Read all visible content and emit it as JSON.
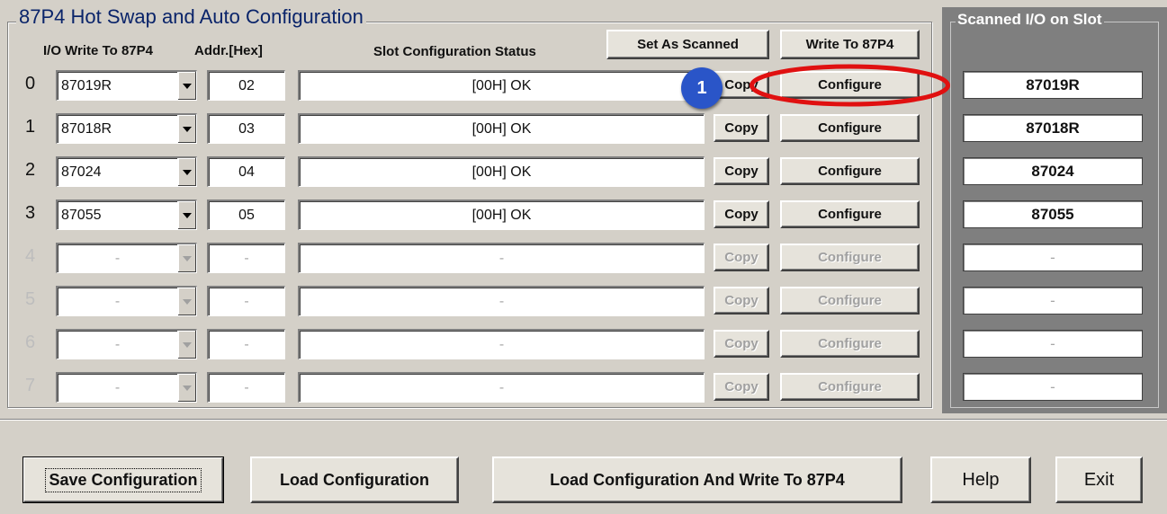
{
  "window": {
    "group_title": "87P4 Hot Swap and Auto Configuration",
    "col_io": "I/O Write To 87P4",
    "col_addr": "Addr.[Hex]",
    "col_status": "Slot Configuration Status",
    "set_as_scanned": "Set As Scanned",
    "write_to_87p4": "Write To 87P4"
  },
  "rows": [
    {
      "num": "0",
      "module": "87019R",
      "addr": "02",
      "status": "[00H] OK",
      "copy": "Copy",
      "configure": "Configure",
      "scanned": "87019R"
    },
    {
      "num": "1",
      "module": "87018R",
      "addr": "03",
      "status": "[00H] OK",
      "copy": "Copy",
      "configure": "Configure",
      "scanned": "87018R"
    },
    {
      "num": "2",
      "module": "87024",
      "addr": "04",
      "status": "[00H] OK",
      "copy": "Copy",
      "configure": "Configure",
      "scanned": "87024"
    },
    {
      "num": "3",
      "module": "87055",
      "addr": "05",
      "status": "[00H] OK",
      "copy": "Copy",
      "configure": "Configure",
      "scanned": "87055"
    },
    {
      "num": "4",
      "module": "-",
      "addr": "-",
      "status": "-",
      "copy": "Copy",
      "configure": "Configure",
      "scanned": "-"
    },
    {
      "num": "5",
      "module": "-",
      "addr": "-",
      "status": "-",
      "copy": "Copy",
      "configure": "Configure",
      "scanned": "-"
    },
    {
      "num": "6",
      "module": "-",
      "addr": "-",
      "status": "-",
      "copy": "Copy",
      "configure": "Configure",
      "scanned": "-"
    },
    {
      "num": "7",
      "module": "-",
      "addr": "-",
      "status": "-",
      "copy": "Copy",
      "configure": "Configure",
      "scanned": "-"
    }
  ],
  "scan_panel": {
    "title": "Scanned I/O on Slot"
  },
  "bottom": {
    "save": "Save Configuration",
    "load": "Load Configuration",
    "load_write": "Load  Configuration And Write To 87P4",
    "help": "Help",
    "exit": "Exit"
  },
  "annotation": {
    "badge": "1",
    "badge_color": "#2a55c8",
    "ring_color": "#e01010"
  }
}
